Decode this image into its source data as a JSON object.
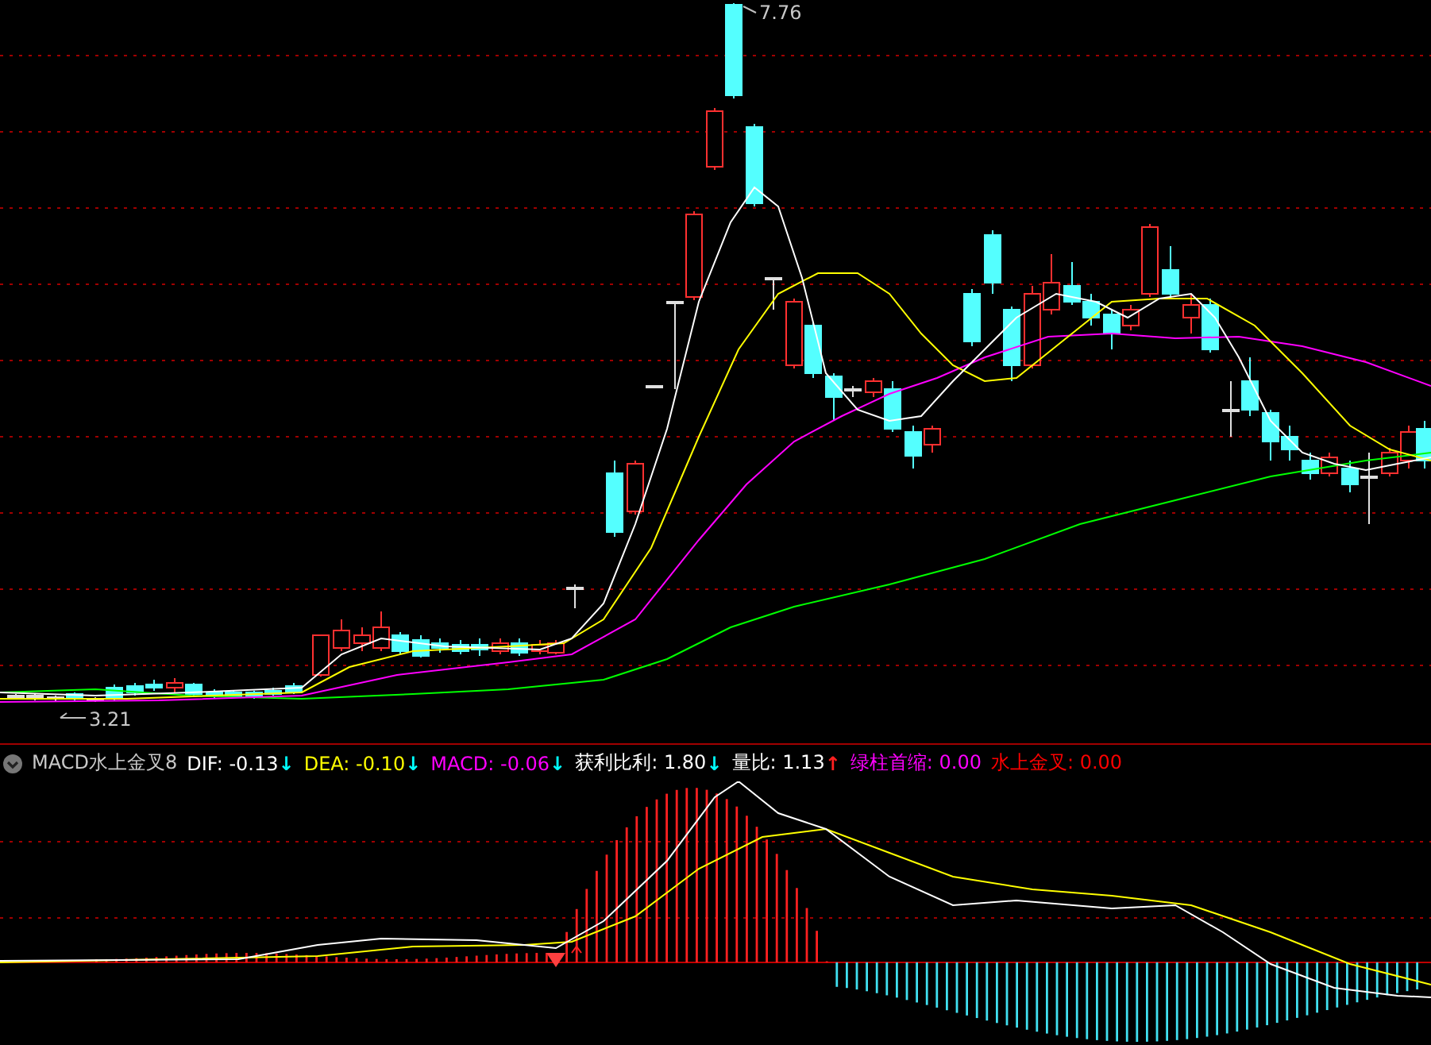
{
  "price_chart": {
    "high_label": "7.76",
    "low_label": "3.21"
  },
  "indicator_bar": {
    "title": "MACD水上金叉8",
    "items": [
      {
        "label": "DIF: ",
        "value": "-0.13",
        "arrow": {
          "text": "↓",
          "color": "#00ffff"
        },
        "color": "#ffffff"
      },
      {
        "label": "DEA: ",
        "value": "-0.10",
        "arrow": {
          "text": "↓",
          "color": "#00ffff"
        },
        "color": "#ffff00"
      },
      {
        "label": "MACD: ",
        "value": "-0.06",
        "arrow": {
          "text": "↓",
          "color": "#00ffff"
        },
        "color": "#ff00ff"
      },
      {
        "label": "获利比利: ",
        "value": "1.80",
        "arrow": {
          "text": "↓",
          "color": "#00ffff"
        },
        "color": "#ffffff"
      },
      {
        "label": "量比: ",
        "value": "1.13",
        "arrow": {
          "text": "↑",
          "color": "#ff2020"
        },
        "color": "#ffffff"
      },
      {
        "label": "绿柱首缩: ",
        "value": "0.00",
        "color": "#ff00ff"
      },
      {
        "label": "水上金叉: ",
        "value": "0.00",
        "color": "#ff0000"
      }
    ]
  }
}
